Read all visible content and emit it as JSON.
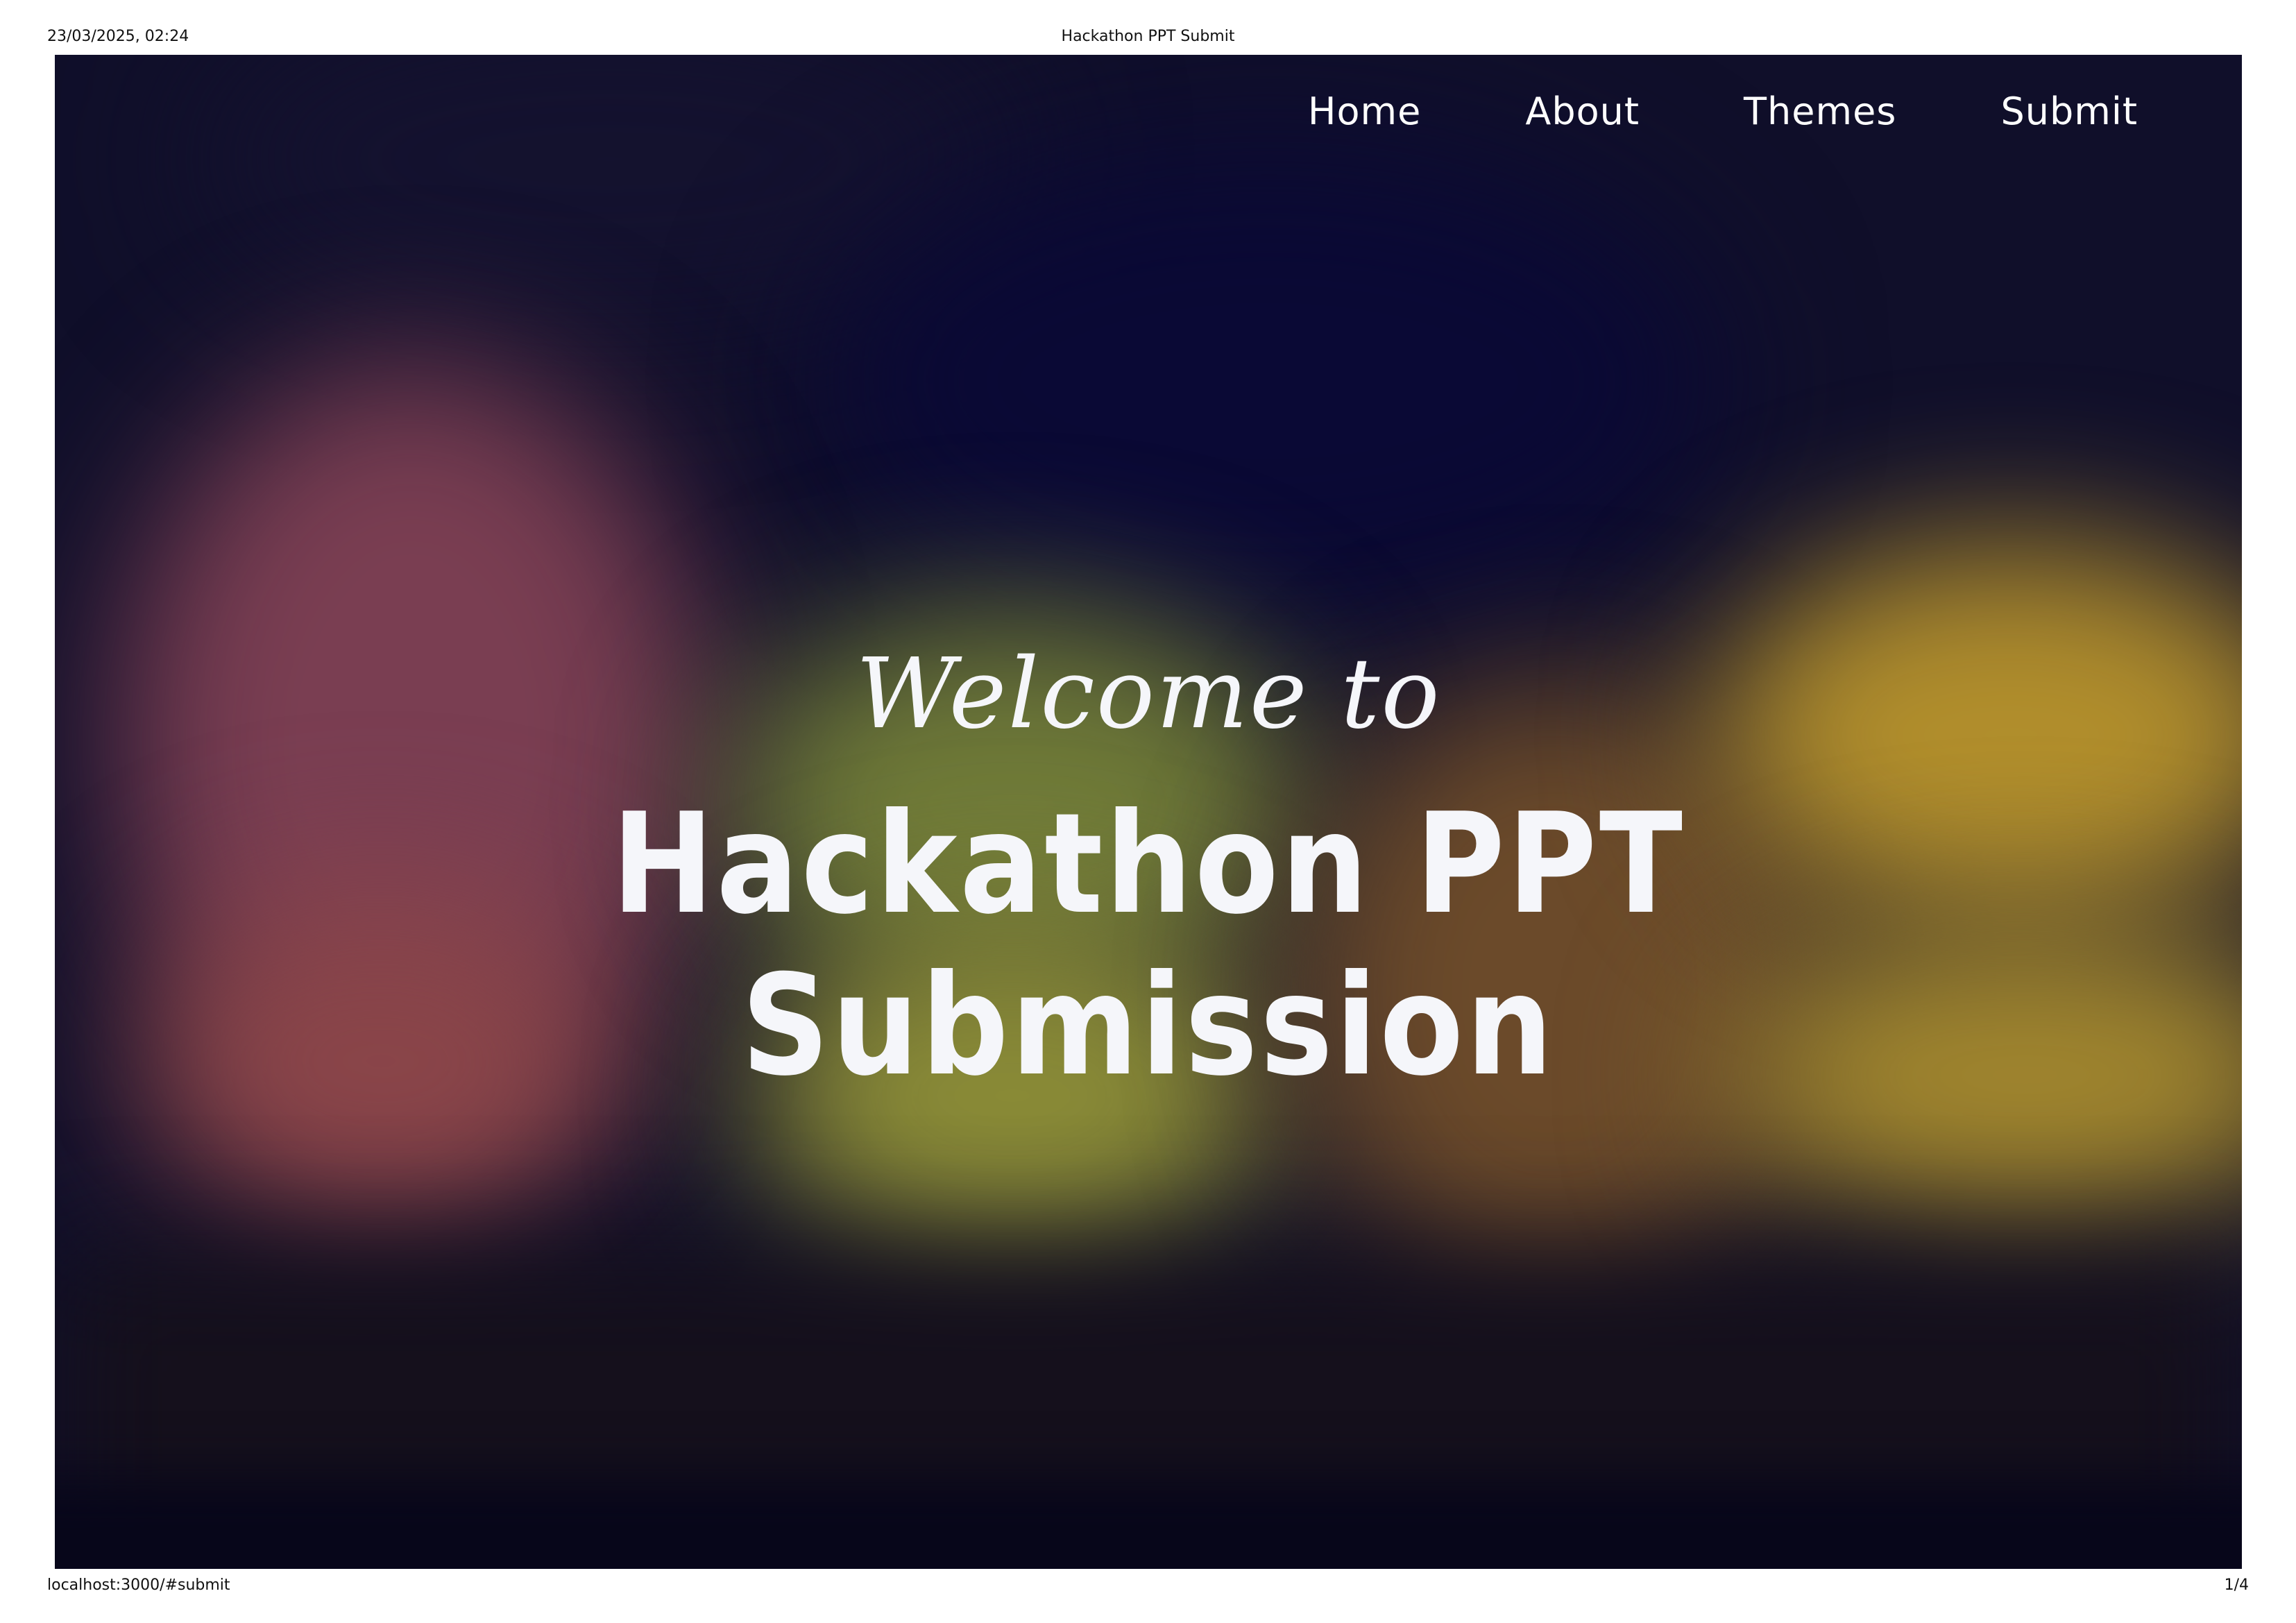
{
  "print": {
    "datetime": "23/03/2025, 02:24",
    "page_title": "Hackathon PPT Submit",
    "url": "localhost:3000/#submit",
    "page_number": "1/4"
  },
  "nav": {
    "items": [
      {
        "label": "Home"
      },
      {
        "label": "About"
      },
      {
        "label": "Themes"
      },
      {
        "label": "Submit"
      }
    ]
  },
  "hero": {
    "welcome": "Welcome to",
    "title": "Hackathon PPT Submission"
  },
  "colors": {
    "background": "#100f2a",
    "text": "#f5f6fa",
    "accent_red": "#7a3e52",
    "accent_olive": "#6f7a38",
    "accent_yellow": "#b18e2c"
  }
}
